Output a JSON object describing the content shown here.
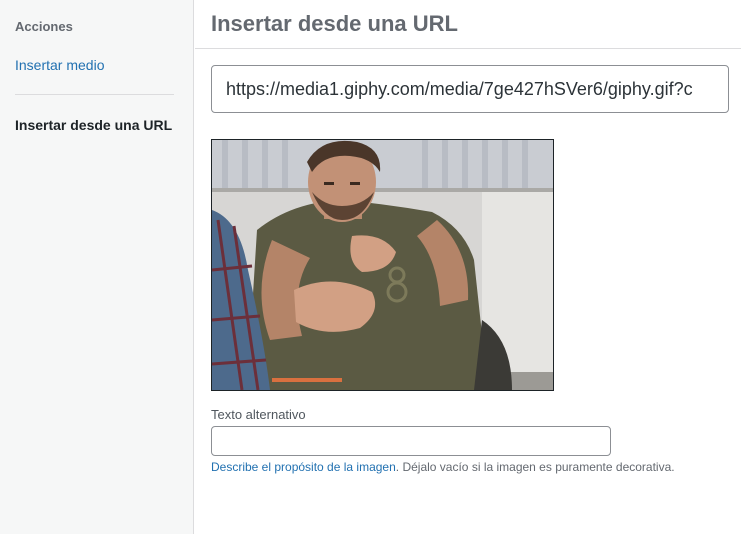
{
  "sidebar": {
    "heading": "Acciones",
    "items": [
      {
        "label": "Insertar medio",
        "active": false
      },
      {
        "label": "Insertar desde una URL",
        "active": true
      }
    ]
  },
  "frame": {
    "title": "Insertar desde una URL"
  },
  "url_field": {
    "value": "https://media1.giphy.com/media/7ge427hSVer6/giphy.gif?c"
  },
  "preview": {
    "description": "animated gif preview"
  },
  "alt_text": {
    "label": "Texto alternativo",
    "value": "",
    "help_link": "Describe el propósito de la imagen",
    "help_rest": ". Déjalo vacío si la imagen es puramente decorativa."
  },
  "colors": {
    "link": "#2271b1",
    "sidebar_bg": "#f6f7f7",
    "border": "#dcdcde"
  }
}
